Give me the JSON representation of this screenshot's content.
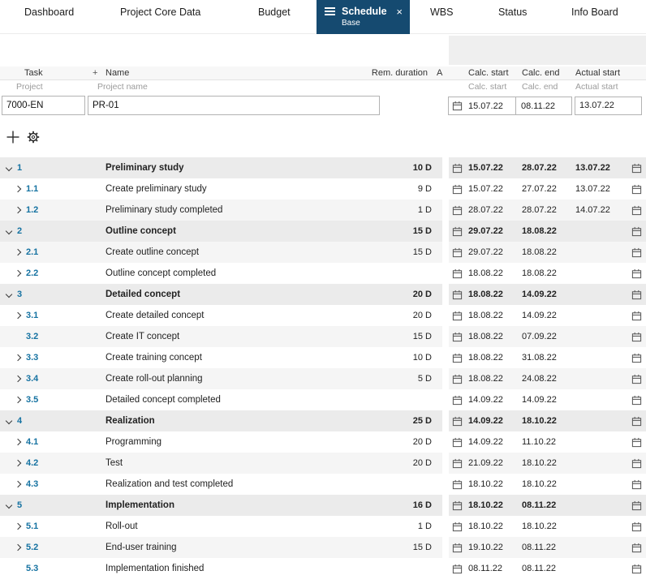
{
  "tabs": {
    "dashboard": "Dashboard",
    "project_core_data": "Project Core Data",
    "budget": "Budget",
    "schedule": "Schedule",
    "schedule_sub": "Base",
    "wbs": "WBS",
    "status": "Status",
    "info_board": "Info Board"
  },
  "icons": {
    "close": "×",
    "header_add": "+",
    "menu": "hamburger-icon",
    "add_task": "plus-icon",
    "settings": "gear-icon",
    "calendar": "calendar-icon"
  },
  "columns": {
    "task": "Task",
    "name": "Name",
    "rem_duration": "Rem. duration",
    "a_truncated": "A",
    "calc_start": "Calc. start",
    "calc_end": "Calc. end",
    "actual_start": "Actual start"
  },
  "subcolumns": {
    "project": "Project",
    "project_name": "Project name",
    "calc_start": "Calc. start",
    "calc_end": "Calc. end",
    "actual_start": "Actual start"
  },
  "project": {
    "id": "7000-EN",
    "name": "PR-01",
    "calc_start": "15.07.22",
    "calc_end": "08.11.22",
    "actual_start": "13.07.22"
  },
  "colors": {
    "active_tab": "#154a70",
    "task_number": "#1572a1",
    "group_row_bg": "#ebebeb",
    "alt_row_bg": "#f5f5f5"
  },
  "grid": {
    "rows": [
      {
        "num": "1",
        "name": "Preliminary study",
        "dur": "10 D",
        "calc_start": "15.07.22",
        "calc_end": "28.07.22",
        "actual_start": "13.07.22",
        "group": true,
        "chev_down": true
      },
      {
        "num": "1.1",
        "name": "Create preliminary study",
        "dur": "9 D",
        "calc_start": "15.07.22",
        "calc_end": "27.07.22",
        "actual_start": "13.07.22",
        "chev_right": true
      },
      {
        "num": "1.2",
        "name": "Preliminary study completed",
        "dur": "1 D",
        "calc_start": "28.07.22",
        "calc_end": "28.07.22",
        "actual_start": "14.07.22",
        "chev_right": true,
        "alt": true
      },
      {
        "num": "2",
        "name": "Outline concept",
        "dur": "15 D",
        "calc_start": "29.07.22",
        "calc_end": "18.08.22",
        "actual_start": "",
        "group": true,
        "chev_down": true
      },
      {
        "num": "2.1",
        "name": "Create outline concept",
        "dur": "15 D",
        "calc_start": "29.07.22",
        "calc_end": "18.08.22",
        "actual_start": "",
        "chev_right": true,
        "alt": true
      },
      {
        "num": "2.2",
        "name": "Outline concept completed",
        "dur": "",
        "calc_start": "18.08.22",
        "calc_end": "18.08.22",
        "actual_start": "",
        "chev_right": true
      },
      {
        "num": "3",
        "name": "Detailed concept",
        "dur": "20 D",
        "calc_start": "18.08.22",
        "calc_end": "14.09.22",
        "actual_start": "",
        "group": true,
        "chev_down": true
      },
      {
        "num": "3.1",
        "name": "Create detailed concept",
        "dur": "20 D",
        "calc_start": "18.08.22",
        "calc_end": "14.09.22",
        "actual_start": "",
        "chev_right": true
      },
      {
        "num": "3.2",
        "name": "Create IT concept",
        "dur": "15 D",
        "calc_start": "18.08.22",
        "calc_end": "07.09.22",
        "actual_start": "",
        "chev_none": true,
        "alt": true
      },
      {
        "num": "3.3",
        "name": "Create training concept",
        "dur": "10 D",
        "calc_start": "18.08.22",
        "calc_end": "31.08.22",
        "actual_start": "",
        "chev_right": true
      },
      {
        "num": "3.4",
        "name": "Create roll-out planning",
        "dur": "5 D",
        "calc_start": "18.08.22",
        "calc_end": "24.08.22",
        "actual_start": "",
        "chev_right": true,
        "alt": true
      },
      {
        "num": "3.5",
        "name": "Detailed concept completed",
        "dur": "",
        "calc_start": "14.09.22",
        "calc_end": "14.09.22",
        "actual_start": "",
        "chev_right": true
      },
      {
        "num": "4",
        "name": "Realization",
        "dur": "25 D",
        "calc_start": "14.09.22",
        "calc_end": "18.10.22",
        "actual_start": "",
        "group": true,
        "chev_down": true
      },
      {
        "num": "4.1",
        "name": "Programming",
        "dur": "20 D",
        "calc_start": "14.09.22",
        "calc_end": "11.10.22",
        "actual_start": "",
        "chev_right": true
      },
      {
        "num": "4.2",
        "name": "Test",
        "dur": "20 D",
        "calc_start": "21.09.22",
        "calc_end": "18.10.22",
        "actual_start": "",
        "chev_right": true,
        "alt": true
      },
      {
        "num": "4.3",
        "name": "Realization and test completed",
        "dur": "",
        "calc_start": "18.10.22",
        "calc_end": "18.10.22",
        "actual_start": "",
        "chev_right": true
      },
      {
        "num": "5",
        "name": "Implementation",
        "dur": "16 D",
        "calc_start": "18.10.22",
        "calc_end": "08.11.22",
        "actual_start": "",
        "group": true,
        "chev_down": true
      },
      {
        "num": "5.1",
        "name": "Roll-out",
        "dur": "1 D",
        "calc_start": "18.10.22",
        "calc_end": "18.10.22",
        "actual_start": "",
        "chev_right": true
      },
      {
        "num": "5.2",
        "name": "End-user training",
        "dur": "15 D",
        "calc_start": "19.10.22",
        "calc_end": "08.11.22",
        "actual_start": "",
        "chev_right": true,
        "alt": true
      },
      {
        "num": "5.3",
        "name": "Implementation finished",
        "dur": "",
        "calc_start": "08.11.22",
        "calc_end": "08.11.22",
        "actual_start": "",
        "chev_none": true
      }
    ]
  }
}
